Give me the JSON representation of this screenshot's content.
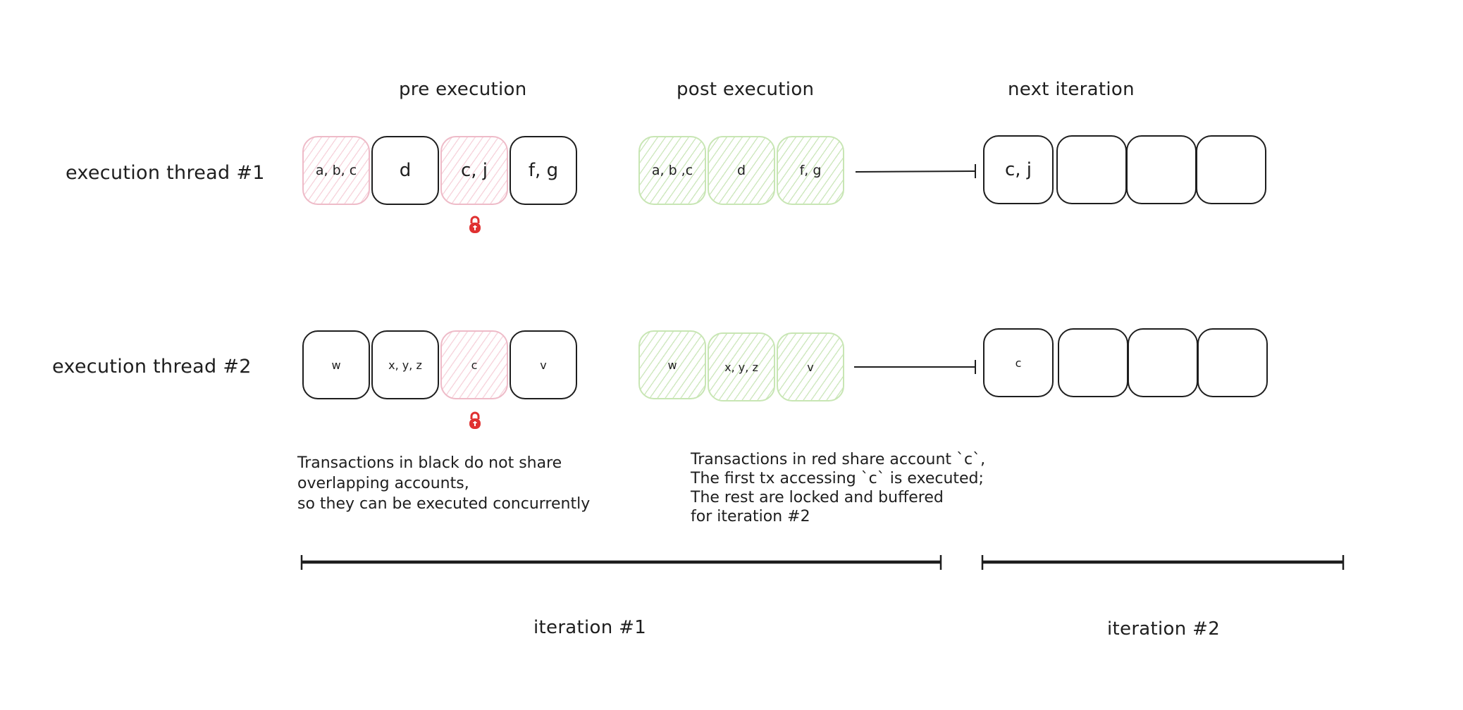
{
  "headers": {
    "pre": "pre execution",
    "post": "post execution",
    "next": "next iteration"
  },
  "threads": [
    {
      "label": "execution thread #1",
      "pre": [
        {
          "text": "a, b, c",
          "state": "conflict"
        },
        {
          "text": "d",
          "state": "free"
        },
        {
          "text": "c, j",
          "state": "conflict",
          "locked": true
        },
        {
          "text": "f, g",
          "state": "free"
        }
      ],
      "post": [
        {
          "text": "a, b ,c",
          "state": "executed"
        },
        {
          "text": "d",
          "state": "executed"
        },
        {
          "text": "f, g",
          "state": "executed"
        }
      ],
      "next": [
        "c, j",
        "",
        "",
        ""
      ]
    },
    {
      "label": "execution thread #2",
      "pre": [
        {
          "text": "w",
          "state": "free"
        },
        {
          "text": "x, y, z",
          "state": "free"
        },
        {
          "text": "c",
          "state": "conflict",
          "locked": true
        },
        {
          "text": "v",
          "state": "free"
        }
      ],
      "post": [
        {
          "text": "w",
          "state": "executed"
        },
        {
          "text": "x, y, z",
          "state": "executed"
        },
        {
          "text": "v",
          "state": "executed"
        }
      ],
      "next": [
        "c",
        "",
        "",
        ""
      ]
    }
  ],
  "notes": {
    "black": [
      "Transactions in black do not share",
      "overlapping accounts,",
      "so they can be executed concurrently"
    ],
    "red": [
      "Transactions in red share account `c`,",
      "The first tx accessing `c` is executed;",
      "The rest are locked and buffered",
      "for iteration #2"
    ]
  },
  "iterations": {
    "first": "iteration #1",
    "second": "iteration #2"
  },
  "colors": {
    "conflict_stroke": "#eebbc8",
    "executed_stroke": "#c8e6b4",
    "lock": "#e03131",
    "ink": "#1e1e1e"
  }
}
